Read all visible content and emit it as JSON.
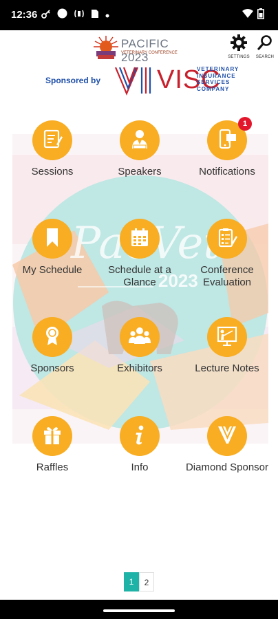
{
  "status_bar": {
    "time": "12:36"
  },
  "header": {
    "event_logo_text": "PACIFIC 2023",
    "event_logo_subtitle": "VETERINARY CONFERENCE",
    "settings_label": "SETTINGS",
    "search_label": "SEARCH",
    "sponsored_by": "Sponsored by",
    "sponsor_logo_text": "VISC",
    "sponsor_logo_subtitle": "VETERINARY INSURANCE SERVICES COMPANY"
  },
  "background_art": {
    "title_text": "PacVet",
    "year_text": "2023"
  },
  "menu": {
    "items": [
      {
        "label": "Sessions",
        "icon": "sessions-icon"
      },
      {
        "label": "Speakers",
        "icon": "speaker-icon"
      },
      {
        "label": "Notifications",
        "icon": "notification-icon",
        "badge": "1"
      },
      {
        "label": "My Schedule",
        "icon": "bookmark-icon"
      },
      {
        "label": "Schedule at a Glance",
        "icon": "calendar-icon"
      },
      {
        "label": "Conference Evaluation",
        "icon": "evaluation-icon"
      },
      {
        "label": "Sponsors",
        "icon": "award-icon"
      },
      {
        "label": "Exhibitors",
        "icon": "group-icon"
      },
      {
        "label": "Lecture Notes",
        "icon": "presentation-icon"
      },
      {
        "label": "Raffles",
        "icon": "gift-icon"
      },
      {
        "label": "Info",
        "icon": "info-icon"
      },
      {
        "label": "Diamond Sponsor",
        "icon": "diamond-sponsor-icon"
      }
    ]
  },
  "pagination": {
    "pages": [
      "1",
      "2"
    ],
    "current": "1"
  },
  "colors": {
    "icon_bg": "#f8ad22",
    "badge": "#e3172c",
    "page_active": "#1fb2a6",
    "sponsor_blue": "#1f4fa8",
    "sponsor_red": "#c8202c"
  }
}
